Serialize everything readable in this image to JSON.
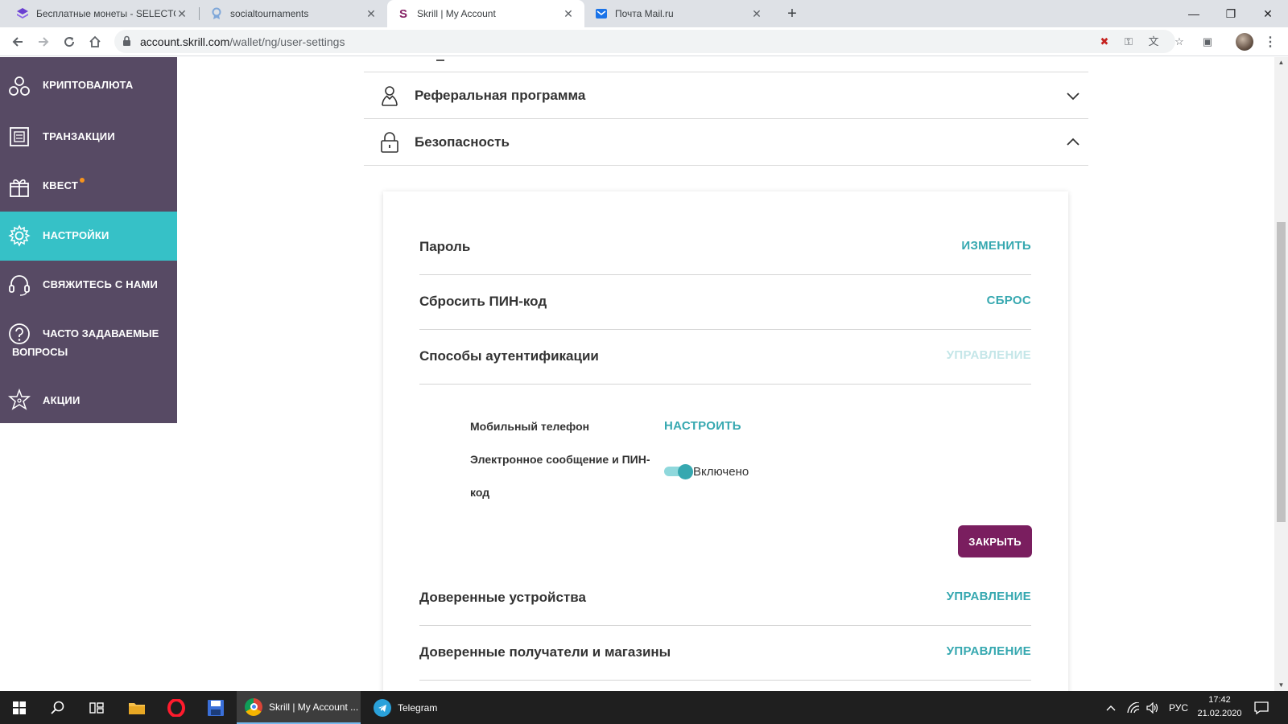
{
  "browser": {
    "tabs": [
      {
        "title": "Бесплатные монеты - SELECTOR",
        "icon": "selector-logo-icon"
      },
      {
        "title": "socialtournaments",
        "icon": "socialtournaments-icon"
      },
      {
        "title": "Skrill | My Account",
        "icon": "skrill-logo-icon",
        "active": true
      },
      {
        "title": "Почта Mail.ru",
        "icon": "mail-ru-icon"
      }
    ],
    "url_host": "account.skrill.com",
    "url_path": "/wallet/ng/user-settings"
  },
  "sidebar": {
    "items": [
      {
        "label": "Криптовалюта",
        "icon": "crypto-icon"
      },
      {
        "label": "Транзакции",
        "icon": "transactions-icon"
      },
      {
        "label": "Квест",
        "icon": "gift-icon",
        "badge": true
      },
      {
        "label": "Настройки",
        "icon": "gear-icon",
        "active": true
      },
      {
        "label": "Свяжитесь с нами",
        "icon": "headset-icon"
      },
      {
        "label": "Часто задаваемые вопросы",
        "icon": "question-icon"
      },
      {
        "label": "Акции",
        "icon": "star-icon"
      }
    ]
  },
  "accordion": {
    "referral": "Реферальная программа",
    "security": "Безопасность"
  },
  "security": {
    "password": {
      "label": "Пароль",
      "action": "ИЗМЕНИТЬ"
    },
    "reset_pin": {
      "label": "Сбросить ПИН-код",
      "action": "СБРОС"
    },
    "auth_methods": {
      "label": "Способы аутентификации",
      "action": "УПРАВЛЕНИЕ"
    },
    "mobile_phone": {
      "label": "Мобильный телефон",
      "action": "НАСТРОИТЬ"
    },
    "email_pin": {
      "label_line1": "Электронное сообщение и ПИН-",
      "label_line2": "код",
      "status": "Включено",
      "enabled": true
    },
    "close_button": "ЗАКРЫТЬ",
    "trusted_devices": {
      "label": "Доверенные устройства",
      "action": "УПРАВЛЕНИЕ"
    },
    "trusted_recipients": {
      "label": "Доверенные получатели и магазины",
      "action": "УПРАВЛЕНИЕ"
    }
  },
  "taskbar": {
    "apps": [
      {
        "label": "Skrill | My Account ...",
        "icon": "chrome-icon",
        "active": true
      },
      {
        "label": "Telegram",
        "icon": "telegram-icon"
      }
    ],
    "language": "РУС",
    "time": "17:42",
    "date": "21.02.2020"
  },
  "colors": {
    "sidebar_bg": "#574a64",
    "sidebar_active": "#36c1c7",
    "link": "#36a8b0",
    "close_button": "#7a1e5f"
  }
}
